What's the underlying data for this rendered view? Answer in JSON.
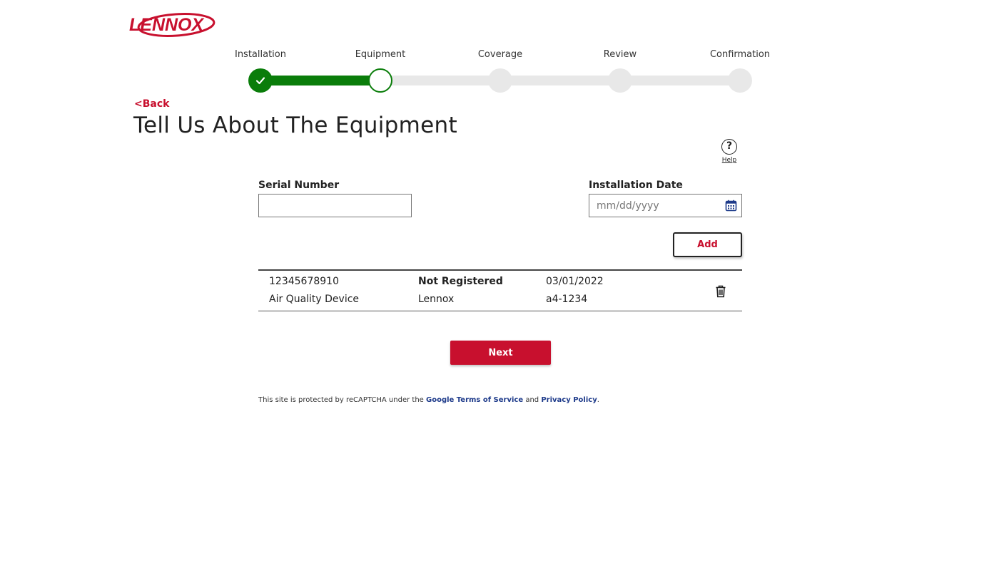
{
  "brand": {
    "logo_text": "LENNOX",
    "accent_color": "#c8102e",
    "progress_color": "#0a7d0a"
  },
  "stepper": {
    "steps": [
      {
        "label": "Installation",
        "state": "completed"
      },
      {
        "label": "Equipment",
        "state": "current"
      },
      {
        "label": "Coverage",
        "state": "upcoming"
      },
      {
        "label": "Review",
        "state": "upcoming"
      },
      {
        "label": "Confirmation",
        "state": "upcoming"
      }
    ],
    "completed_icon": "check-icon"
  },
  "nav": {
    "back_label": "<Back"
  },
  "page": {
    "title": "Tell Us About The Equipment"
  },
  "help": {
    "icon": "question-mark",
    "icon_glyph": "?",
    "label": "Help"
  },
  "form": {
    "serial_label": "Serial Number",
    "serial_value": "",
    "date_label": "Installation Date",
    "date_value": "",
    "date_placeholder": "mm/dd/yyyy",
    "calendar_icon": "calendar-icon",
    "add_label": "Add"
  },
  "equipment": {
    "rows": [
      {
        "serial": "12345678910",
        "type": "Air Quality Device",
        "status": "Not Registered",
        "brand": "Lennox",
        "date": "03/01/2022",
        "model": "a4-1234",
        "delete_icon": "trash-icon"
      }
    ]
  },
  "actions": {
    "next_label": "Next"
  },
  "footer": {
    "prefix": "This site is protected by reCAPTCHA under the",
    "terms_link": "Google Terms of Service",
    "middle": "and",
    "privacy_link": "Privacy Policy",
    "suffix": "."
  }
}
